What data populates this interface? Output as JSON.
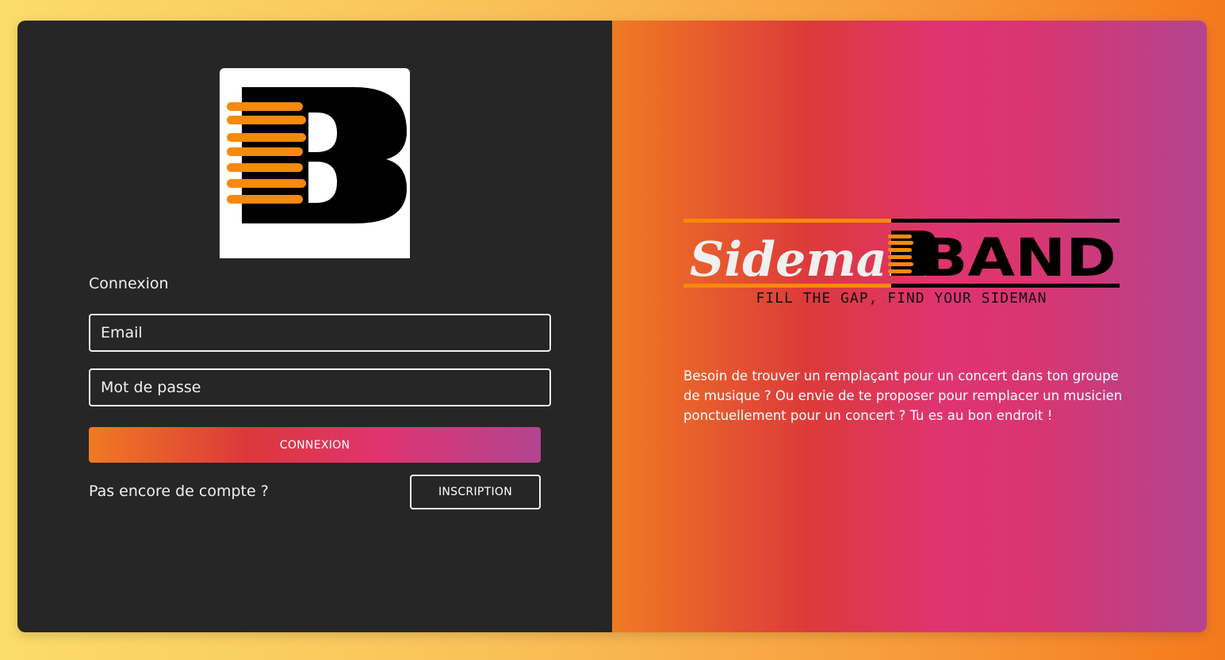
{
  "login": {
    "title": "Connexion",
    "email_placeholder": "Email",
    "password_placeholder": "Mot de passe",
    "submit_label": "CONNEXION",
    "no_account_text": "Pas encore de compte ?",
    "signup_label": "INSCRIPTION"
  },
  "brand": {
    "name_script": "Sideman",
    "name_block": "BAND",
    "tagline": "FILL THE GAP, FIND YOUR SIDEMAN",
    "description": "Besoin de trouver un remplaçant pour un concert dans ton groupe de musique ? Ou envie de te proposer pour remplacer un musicien ponctuellement pour un concert ? Tu es au bon endroit !"
  },
  "colors": {
    "panel_dark": "#262626",
    "accent_orange": "#f5871f",
    "accent_red": "#dc383b",
    "accent_pink": "#df3470",
    "accent_purple": "#b2448f"
  }
}
